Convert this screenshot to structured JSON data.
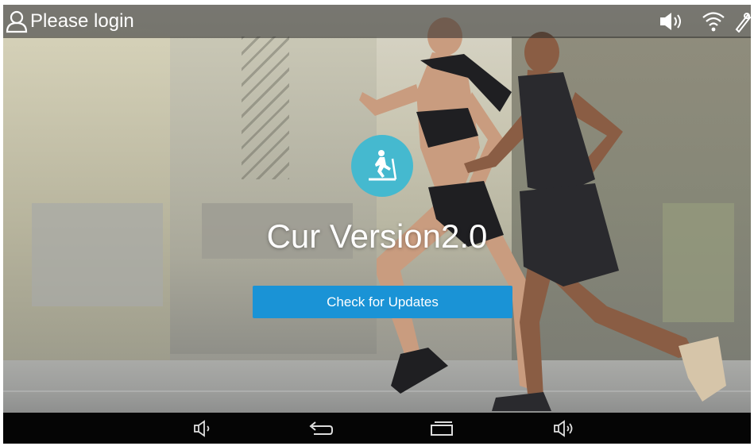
{
  "status_bar": {
    "login_label": "Please login",
    "icons": [
      "user-icon",
      "volume-icon",
      "wifi-icon",
      "settings-icon"
    ]
  },
  "main": {
    "app_icon": "treadmill-icon",
    "version_text": "Cur Version2.0",
    "update_button_label": "Check for Updates"
  },
  "nav_bar": {
    "buttons": [
      "volume-down-icon",
      "back-icon",
      "recent-apps-icon",
      "volume-up-icon"
    ]
  },
  "colors": {
    "accent": "#1a93d6",
    "app_icon_bg": "#45b9cf",
    "status_bar_bg": "#282828",
    "nav_bar_bg": "#050505"
  }
}
